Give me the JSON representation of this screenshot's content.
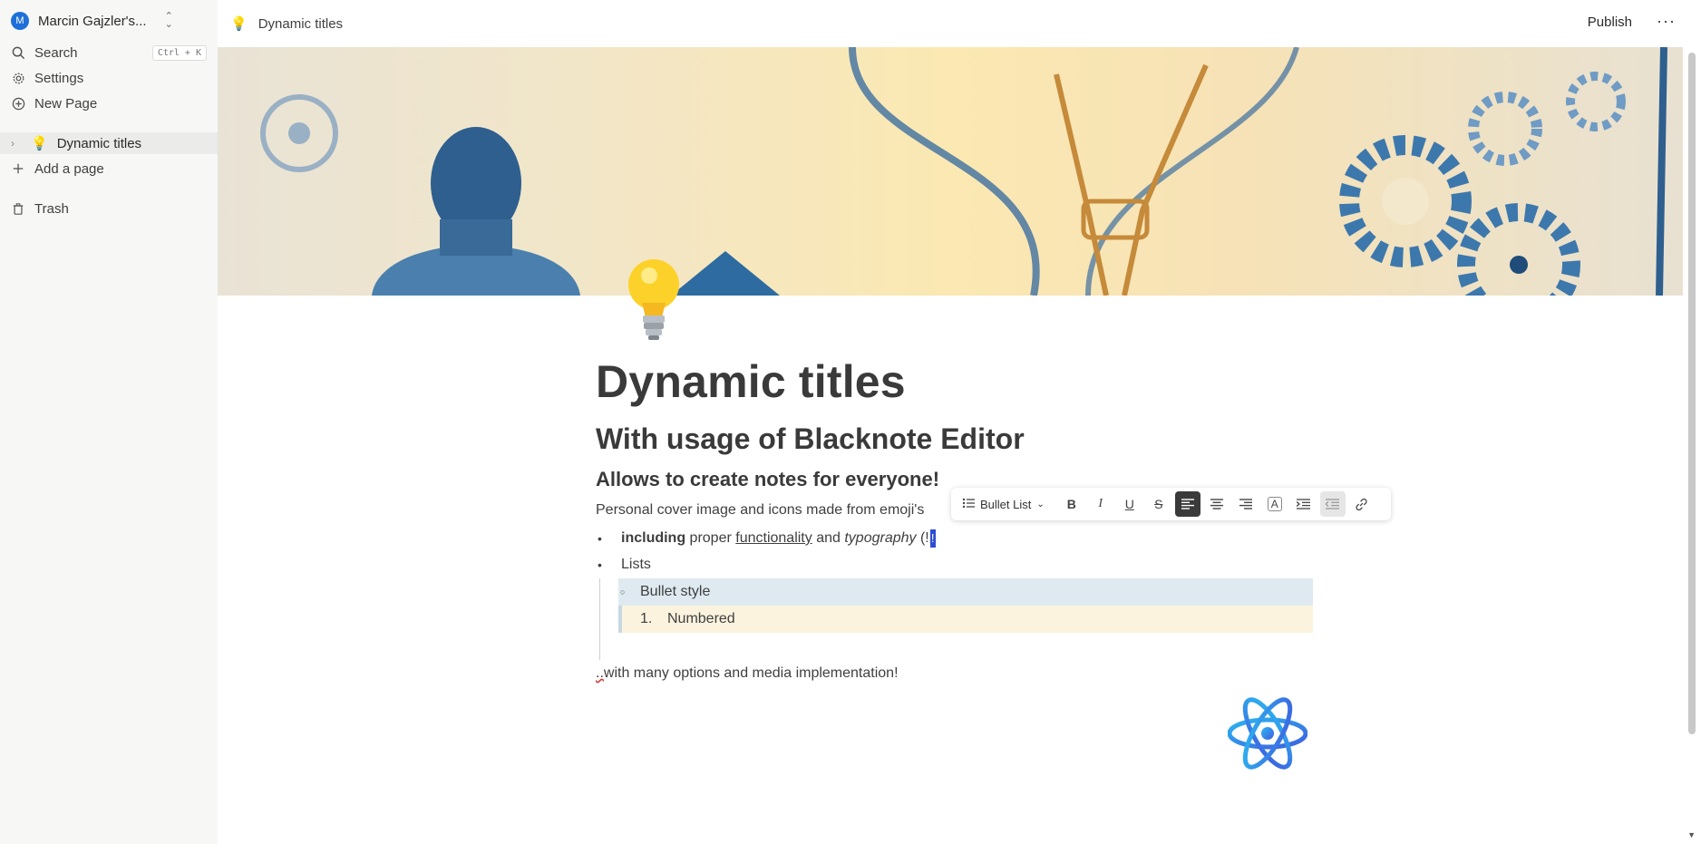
{
  "sidebar": {
    "workspace": {
      "initial": "M",
      "name": "Marcin Gajzler's...",
      "switch_icon": "chevron-updown-icon"
    },
    "search": {
      "label": "Search",
      "shortcut": "Ctrl + K",
      "icon": "search-icon"
    },
    "settings": {
      "label": "Settings",
      "icon": "gear-icon"
    },
    "new_page": {
      "label": "New Page",
      "icon": "plus-circle-icon"
    },
    "pages": [
      {
        "emoji": "💡",
        "label": "Dynamic titles",
        "active": true
      }
    ],
    "add_page": {
      "label": "Add a page",
      "icon": "plus-icon"
    },
    "trash": {
      "label": "Trash",
      "icon": "trash-icon"
    },
    "bg_color": "#f7f7f5"
  },
  "topbar": {
    "emoji": "💡",
    "title": "Dynamic titles",
    "publish_label": "Publish",
    "more_icon": "ellipsis-icon"
  },
  "page": {
    "icon": "lightbulb-icon",
    "h1": "Dynamic titles",
    "h2": "With usage of Blacknote Editor",
    "h3": {
      "before": "Allows to create ",
      "bold": "notes",
      "after": " for everyone!"
    },
    "paragraph": "Personal cover image and icons made from emoji's",
    "list": {
      "item1": {
        "bold": "including",
        "t1": " proper ",
        "underline": "functionality",
        "t2": " and ",
        "italic": "typography",
        "t3": " (!",
        "cursor": "!"
      },
      "item2": "Lists",
      "nested1": "Bullet style",
      "nested2_num": "1.",
      "nested2": "Numbered"
    },
    "last_line_mark": "..",
    "last_line": "with many options and media implementation!",
    "bottom_icon": "atom-icon"
  },
  "toolbar": {
    "block_type": "Bullet List",
    "buttons": [
      "bold",
      "italic",
      "underline",
      "strikethrough",
      "align-left",
      "align-center",
      "align-right",
      "text-color",
      "indent",
      "outdent",
      "link"
    ],
    "active": "align-left",
    "labels": {
      "bold": "B",
      "italic": "I",
      "underline": "U",
      "strike": "S",
      "color": "A"
    }
  },
  "colors": {
    "accent_blue": "#1e6fd9",
    "selection_blue": "#deeaf0",
    "highlight_yellow": "#fbf3de",
    "cursor": "#2d4dd4"
  }
}
